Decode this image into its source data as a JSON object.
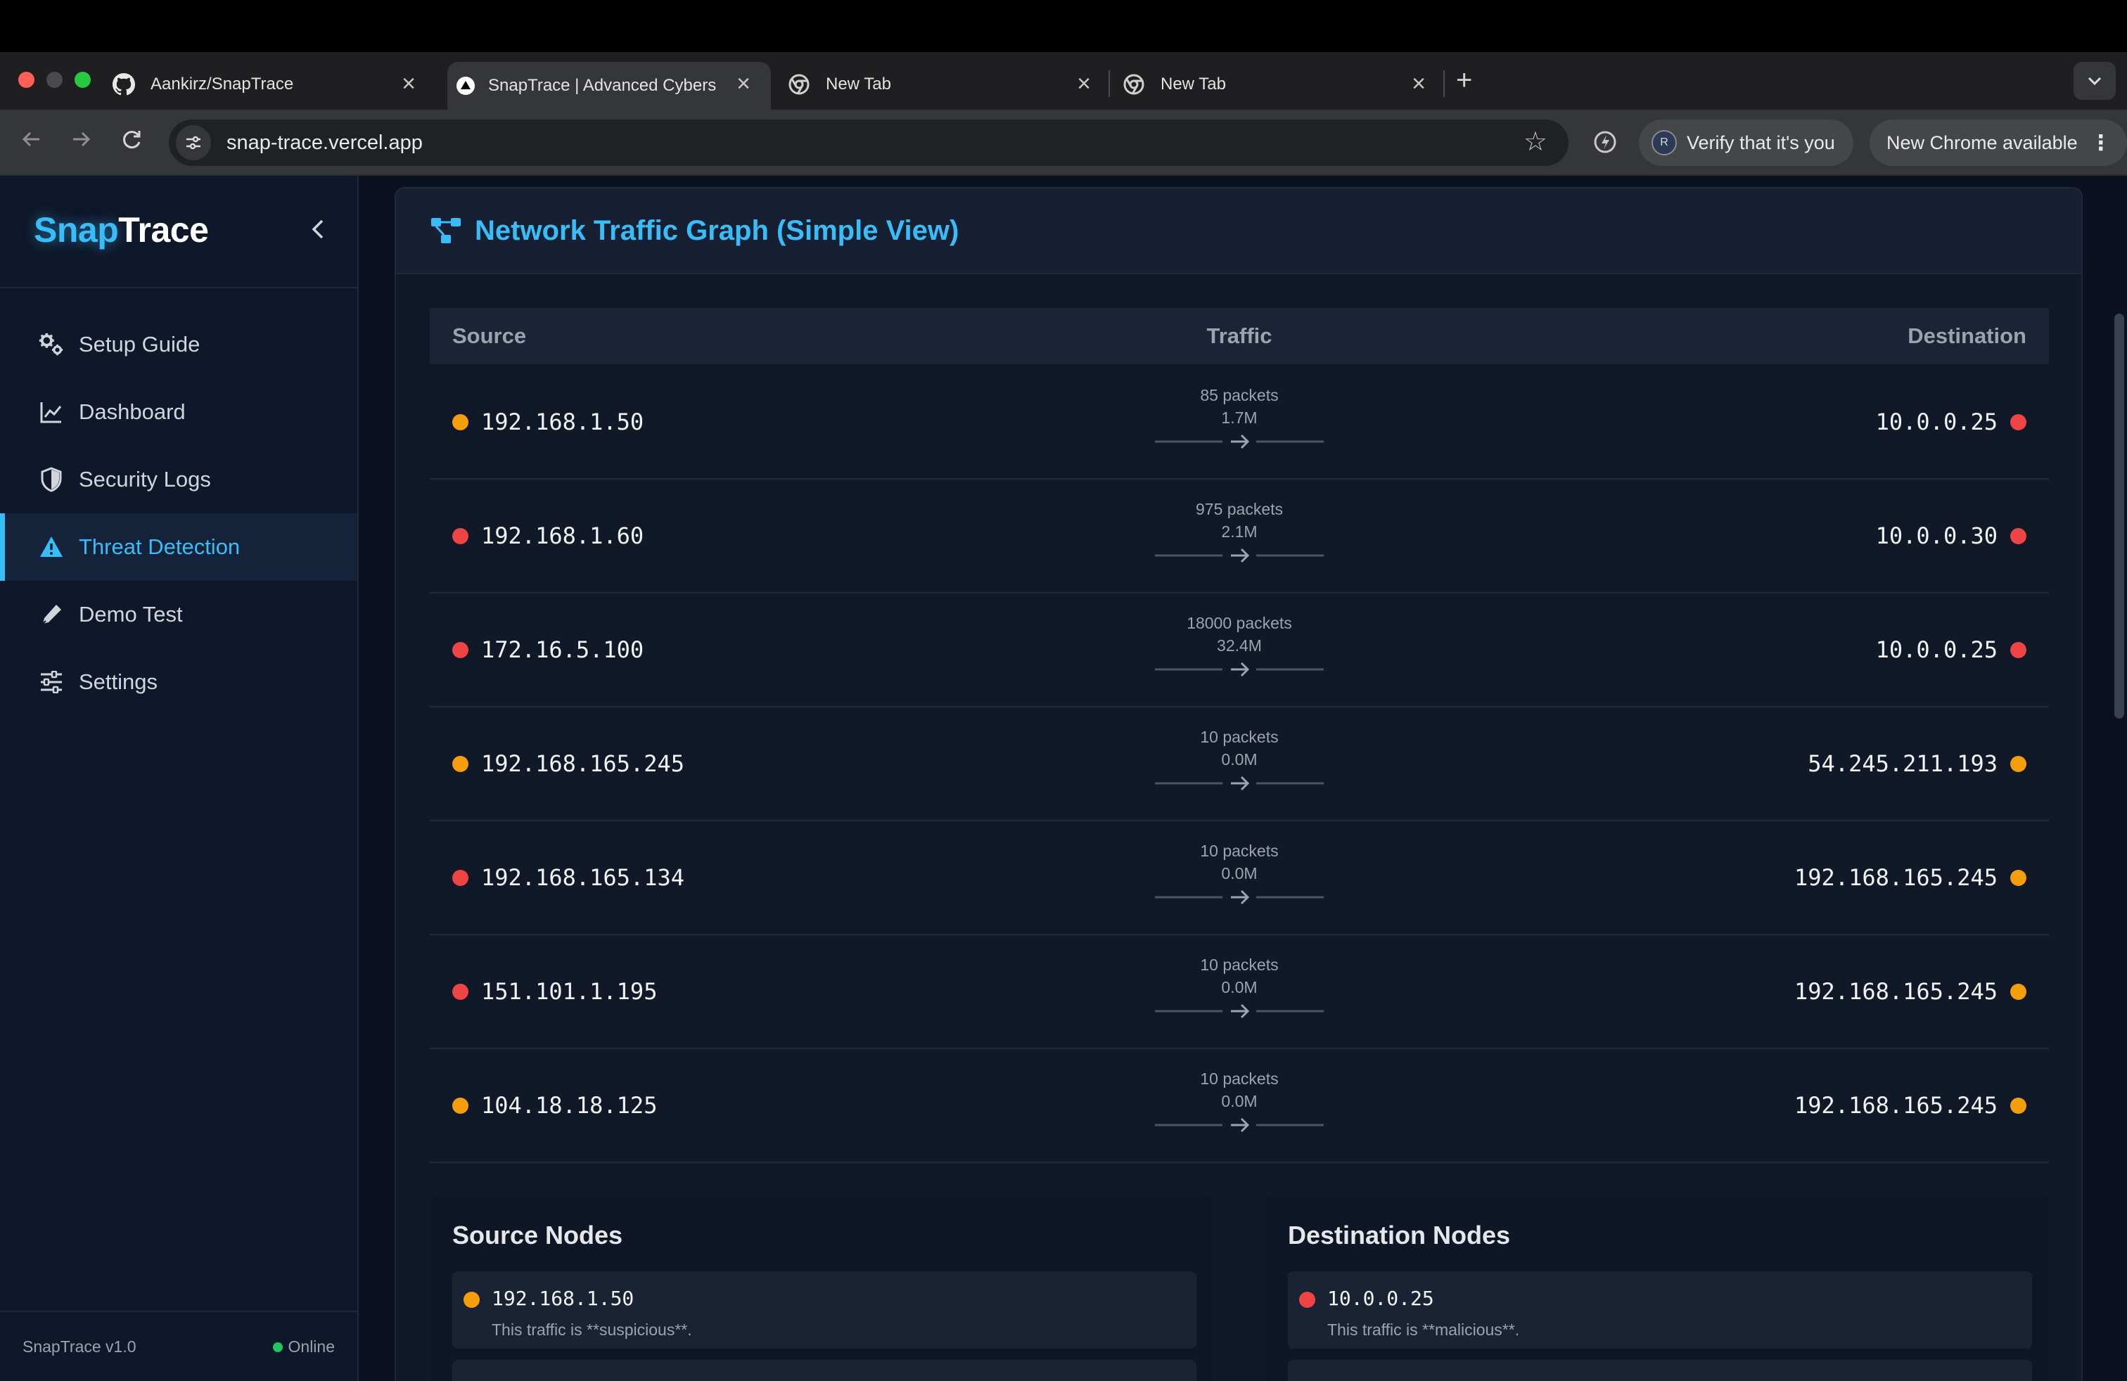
{
  "browser": {
    "tabs": [
      {
        "title": "Aankirz/SnapTrace",
        "icon": "github-icon"
      },
      {
        "title": "SnapTrace | Advanced Cybers",
        "icon": "vercel-icon"
      },
      {
        "title": "New Tab",
        "icon": "chrome-icon"
      },
      {
        "title": "New Tab",
        "icon": "chrome-icon"
      }
    ],
    "new_tab_label": "+",
    "url": "snap-trace.vercel.app",
    "verify_label": "Verify that it's you",
    "profile_initial": "R",
    "update_label": "New Chrome available"
  },
  "app": {
    "logo_part1": "Snap",
    "logo_part2": "Trace",
    "nav": [
      {
        "label": "Setup Guide",
        "icon": "gears-icon"
      },
      {
        "label": "Dashboard",
        "icon": "chart-line-icon"
      },
      {
        "label": "Security Logs",
        "icon": "shield-icon"
      },
      {
        "label": "Threat Detection",
        "icon": "warning-icon",
        "active": true
      },
      {
        "label": "Demo Test",
        "icon": "pen-icon"
      },
      {
        "label": "Settings",
        "icon": "sliders-icon"
      }
    ],
    "version": "SnapTrace v1.0",
    "status": "Online"
  },
  "panel": {
    "title": "Network Traffic Graph (Simple View)",
    "columns": {
      "source": "Source",
      "traffic": "Traffic",
      "destination": "Destination"
    },
    "rows": [
      {
        "source": "192.168.1.50",
        "source_level": "suspicious",
        "packets": "85 packets",
        "bytes": "1.7M",
        "destination": "10.0.0.25",
        "destination_level": "malicious"
      },
      {
        "source": "192.168.1.60",
        "source_level": "malicious",
        "packets": "975 packets",
        "bytes": "2.1M",
        "destination": "10.0.0.30",
        "destination_level": "malicious"
      },
      {
        "source": "172.16.5.100",
        "source_level": "malicious",
        "packets": "18000 packets",
        "bytes": "32.4M",
        "destination": "10.0.0.25",
        "destination_level": "malicious"
      },
      {
        "source": "192.168.165.245",
        "source_level": "suspicious",
        "packets": "10 packets",
        "bytes": "0.0M",
        "destination": "54.245.211.193",
        "destination_level": "suspicious"
      },
      {
        "source": "192.168.165.134",
        "source_level": "malicious",
        "packets": "10 packets",
        "bytes": "0.0M",
        "destination": "192.168.165.245",
        "destination_level": "suspicious"
      },
      {
        "source": "151.101.1.195",
        "source_level": "malicious",
        "packets": "10 packets",
        "bytes": "0.0M",
        "destination": "192.168.165.245",
        "destination_level": "suspicious"
      },
      {
        "source": "104.18.18.125",
        "source_level": "suspicious",
        "packets": "10 packets",
        "bytes": "0.0M",
        "destination": "192.168.165.245",
        "destination_level": "suspicious"
      }
    ],
    "source_nodes_title": "Source Nodes",
    "destination_nodes_title": "Destination Nodes",
    "source_nodes": [
      {
        "ip": "192.168.1.50",
        "level": "suspicious",
        "desc": "This traffic is **suspicious**."
      }
    ],
    "destination_nodes": [
      {
        "ip": "10.0.0.25",
        "level": "malicious",
        "desc": "This traffic is **malicious**."
      }
    ]
  },
  "colors": {
    "accent": "#38bdf8",
    "suspicious": "#f59e0b",
    "malicious": "#ef4444",
    "online": "#22c55e"
  }
}
